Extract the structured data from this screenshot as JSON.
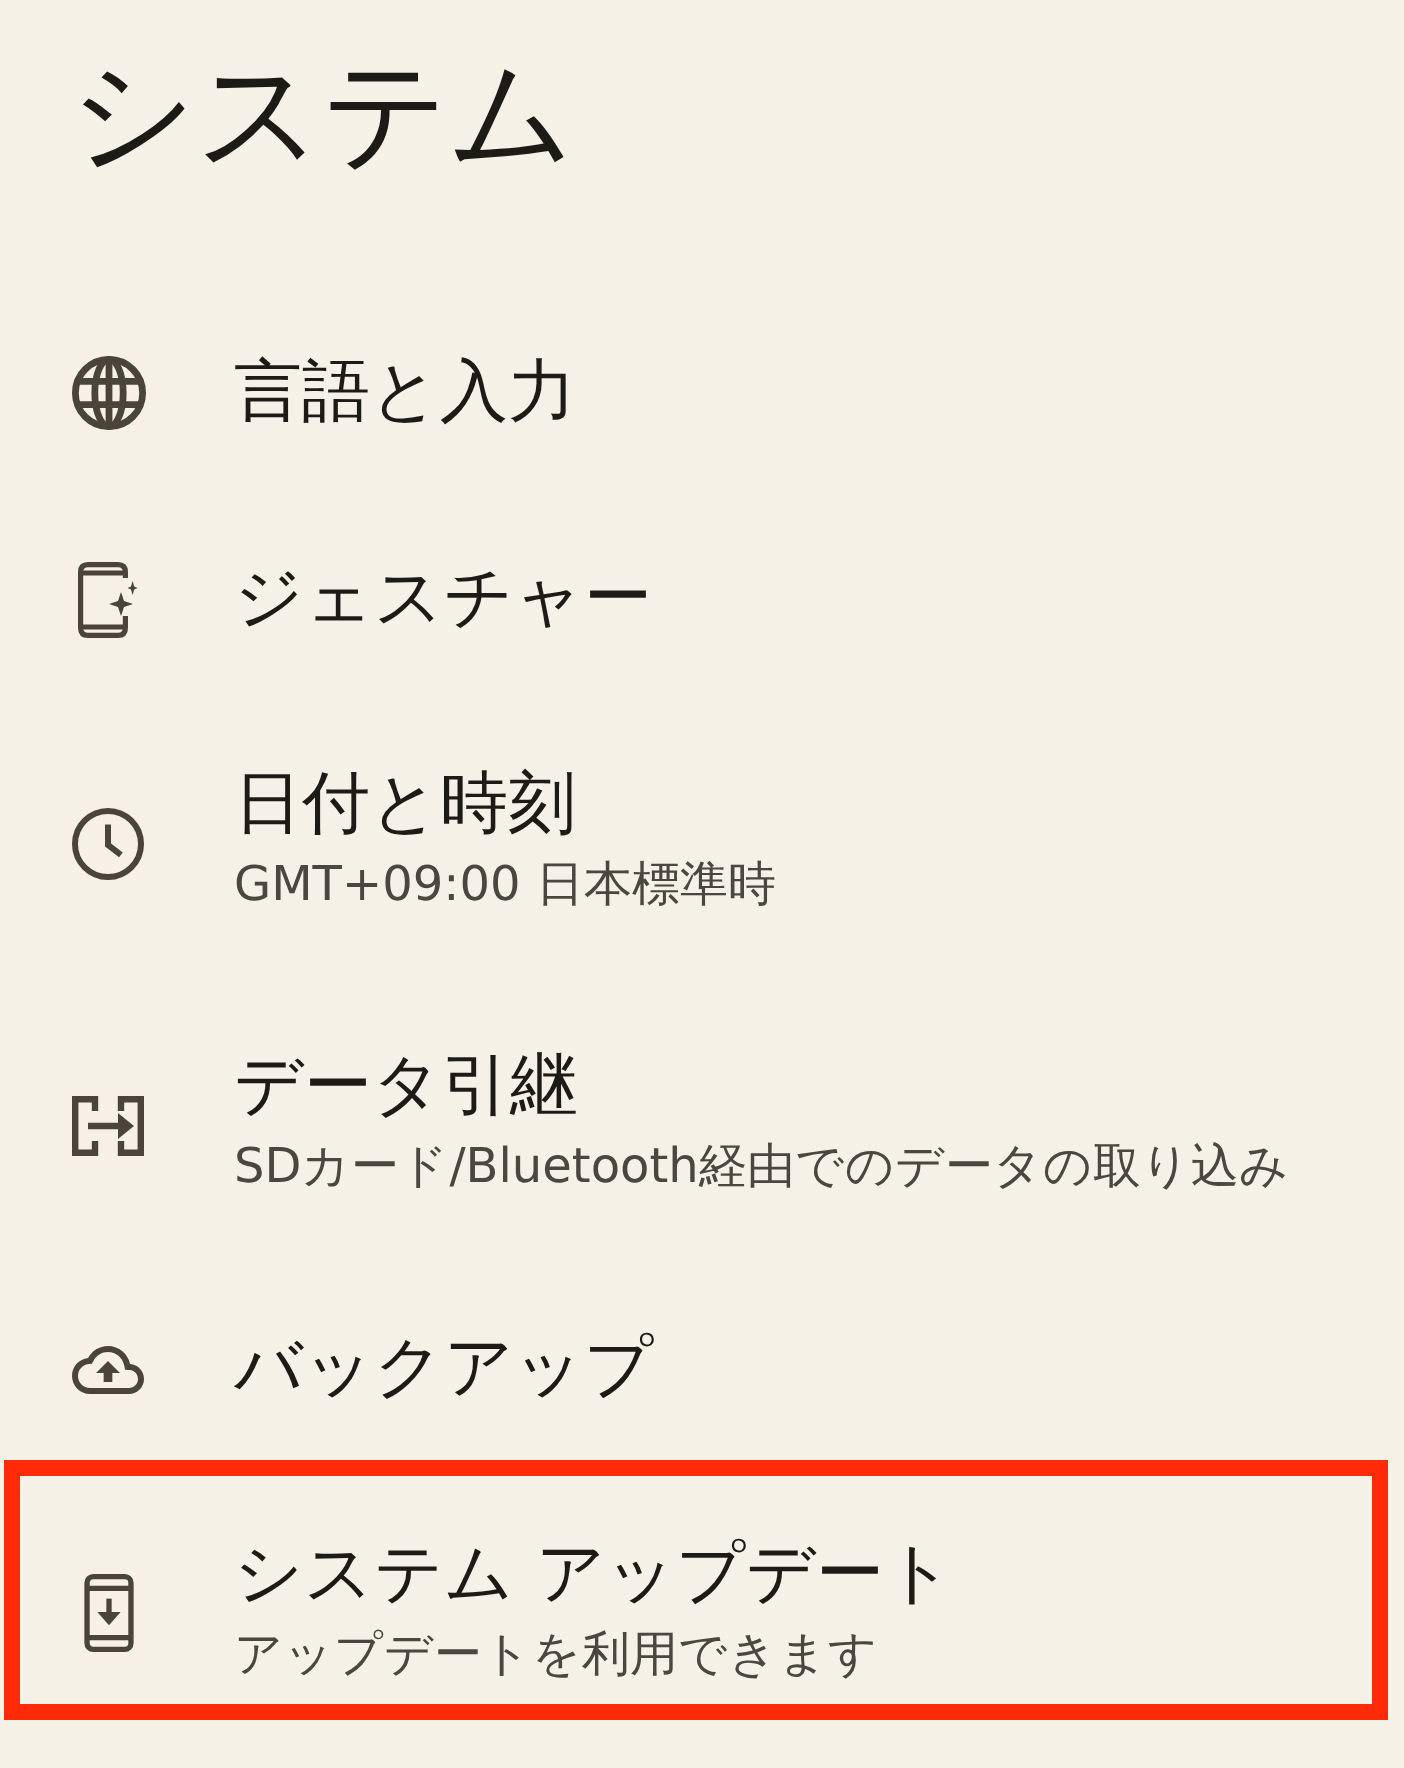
{
  "page": {
    "title": "システム"
  },
  "items": [
    {
      "title": "言語と入力",
      "highlighted": false
    },
    {
      "title": "ジェスチャー",
      "highlighted": false
    },
    {
      "title": "日付と時刻",
      "subtitle": "GMT+09:00 日本標準時",
      "highlighted": false
    },
    {
      "title": "データ引継",
      "subtitle": "SDカード/Bluetooth経由でのデータの取り込み",
      "highlighted": false
    },
    {
      "title": "バックアップ",
      "highlighted": false
    },
    {
      "title": "システム アップデート",
      "subtitle": "アップデートを利用できます",
      "highlighted": true
    }
  ]
}
